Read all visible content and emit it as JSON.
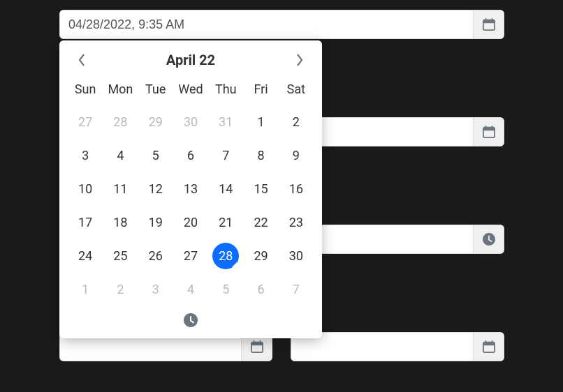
{
  "inputs": {
    "primary": {
      "value": "04/28/2022, 9:35 AM",
      "icon": "calendar"
    },
    "second": {
      "value": "",
      "icon": "calendar"
    },
    "third": {
      "value": "",
      "icon": "clock"
    },
    "fourthL": {
      "value": "",
      "icon": "calendar"
    },
    "fourthR": {
      "value": "",
      "icon": "calendar"
    }
  },
  "datepicker": {
    "title": "April 22",
    "weekdays": [
      "Sun",
      "Mon",
      "Tue",
      "Wed",
      "Thu",
      "Fri",
      "Sat"
    ],
    "weeks": [
      [
        {
          "d": "27",
          "m": true
        },
        {
          "d": "28",
          "m": true
        },
        {
          "d": "29",
          "m": true
        },
        {
          "d": "30",
          "m": true
        },
        {
          "d": "31",
          "m": true
        },
        {
          "d": "1"
        },
        {
          "d": "2"
        }
      ],
      [
        {
          "d": "3"
        },
        {
          "d": "4"
        },
        {
          "d": "5"
        },
        {
          "d": "6"
        },
        {
          "d": "7"
        },
        {
          "d": "8"
        },
        {
          "d": "9"
        }
      ],
      [
        {
          "d": "10"
        },
        {
          "d": "11"
        },
        {
          "d": "12"
        },
        {
          "d": "13"
        },
        {
          "d": "14"
        },
        {
          "d": "15"
        },
        {
          "d": "16"
        }
      ],
      [
        {
          "d": "17"
        },
        {
          "d": "18"
        },
        {
          "d": "19"
        },
        {
          "d": "20"
        },
        {
          "d": "21"
        },
        {
          "d": "22"
        },
        {
          "d": "23"
        }
      ],
      [
        {
          "d": "24"
        },
        {
          "d": "25"
        },
        {
          "d": "26"
        },
        {
          "d": "27"
        },
        {
          "d": "28",
          "sel": true
        },
        {
          "d": "29"
        },
        {
          "d": "30"
        }
      ],
      [
        {
          "d": "1",
          "m": true
        },
        {
          "d": "2",
          "m": true
        },
        {
          "d": "3",
          "m": true
        },
        {
          "d": "4",
          "m": true
        },
        {
          "d": "5",
          "m": true
        },
        {
          "d": "6",
          "m": true
        },
        {
          "d": "7",
          "m": true
        }
      ]
    ]
  }
}
